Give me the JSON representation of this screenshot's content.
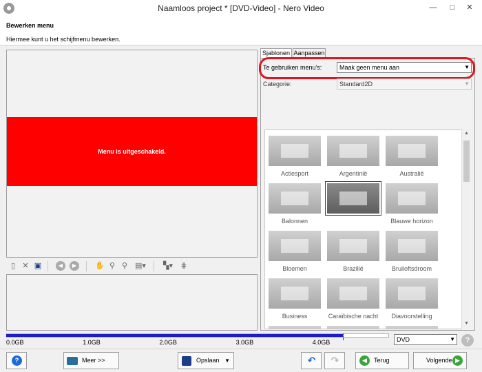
{
  "window": {
    "title": "Naamloos project * [DVD-Video] - Nero Video",
    "minimize_glyph": "—",
    "maximize_glyph": "□",
    "close_glyph": "✕"
  },
  "header": {
    "title": "Bewerken menu",
    "subtitle": "Hiermee kunt u het schijfmenu bewerken."
  },
  "preview": {
    "message": "Menu is uitgeschakeld.",
    "banner_color": "#ff0000"
  },
  "preview_toolbar": {
    "icons": [
      "new-page-icon",
      "delete-icon",
      "save-icon",
      "previous-icon",
      "next-icon",
      "hand-icon",
      "zoom-in-icon",
      "zoom-out-icon",
      "layout-icon",
      "arrange-icon",
      "grid-icon"
    ]
  },
  "tabs": [
    {
      "label": "Sjablonen",
      "active": true
    },
    {
      "label": "Aanpassen",
      "active": false
    }
  ],
  "menus_field": {
    "label": "Te gebruiken menu's:",
    "value": "Maak geen menu aan"
  },
  "category_field": {
    "label": "Categorie:",
    "value": "Standard2D"
  },
  "templates": [
    {
      "label": "Actiesport"
    },
    {
      "label": "Argentinië"
    },
    {
      "label": "Australië"
    },
    {
      "label": "Balonnen"
    },
    {
      "label": ""
    },
    {
      "label": "Blauwe horizon"
    },
    {
      "label": "Bloemen"
    },
    {
      "label": "Brazilië"
    },
    {
      "label": "Bruiloftsdroom"
    },
    {
      "label": "Business"
    },
    {
      "label": "Caraïbische nacht"
    },
    {
      "label": "Diavoorstelling"
    }
  ],
  "capacity": {
    "ticks": [
      "0.0GB",
      "1.0GB",
      "2.0GB",
      "3.0GB",
      "4.0GB"
    ],
    "max_gb": 5.0,
    "used_gb": 4.4,
    "limit_gb": 4.4,
    "fill_color": "#1c1cc8",
    "limit_color": "#e00000"
  },
  "disc_type": {
    "value": "DVD"
  },
  "bottom_bar": {
    "help_glyph": "?",
    "more_label": "Meer >>",
    "save_label": "Opslaan",
    "back_label": "Terug",
    "next_label": "Volgende"
  },
  "accent_colors": {
    "highlight_ring": "#e0141e",
    "nav_green": "#3aa53a",
    "help_blue": "#1f6cd3"
  }
}
